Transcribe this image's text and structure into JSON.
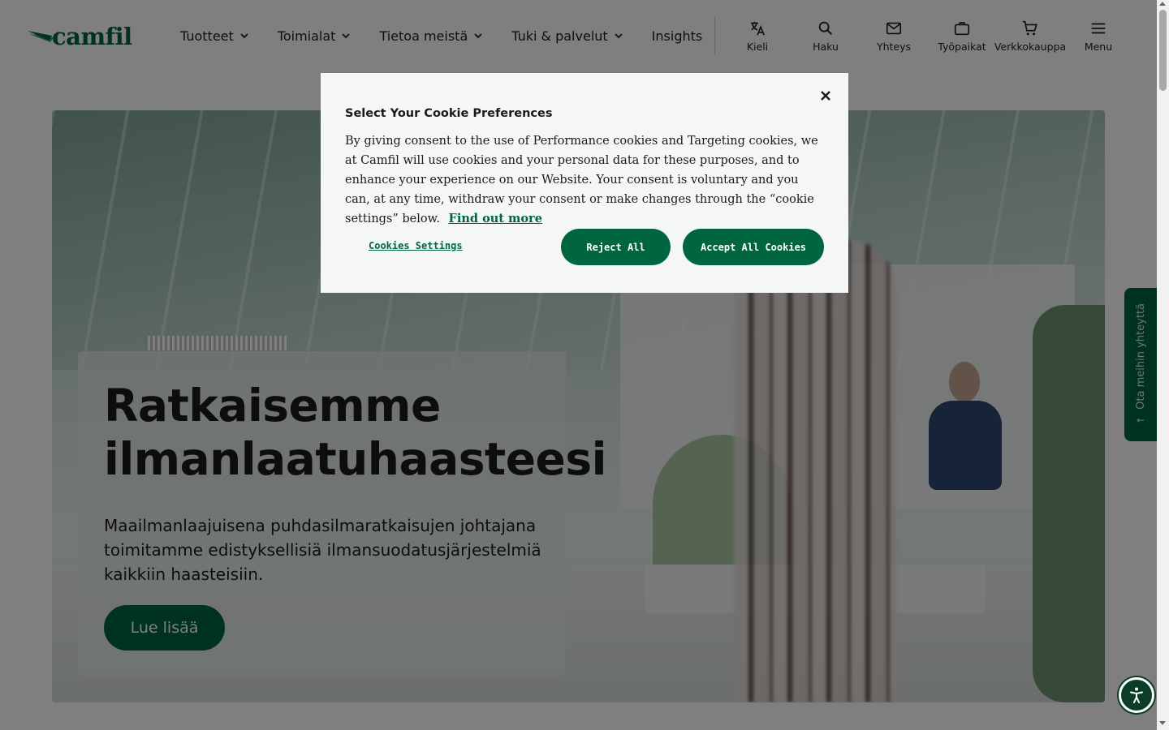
{
  "header": {
    "logo_text": "camfil",
    "nav": [
      {
        "label": "Tuotteet",
        "has_dropdown": true
      },
      {
        "label": "Toimialat",
        "has_dropdown": true
      },
      {
        "label": "Tietoa meistä",
        "has_dropdown": true
      },
      {
        "label": "Tuki & palvelut",
        "has_dropdown": true
      },
      {
        "label": "Insights",
        "has_dropdown": false
      }
    ],
    "icon_nav": [
      {
        "label": "Kieli",
        "icon": "translate-icon"
      },
      {
        "label": "Haku",
        "icon": "search-icon"
      },
      {
        "label": "Yhteys",
        "icon": "mail-icon"
      },
      {
        "label": "Työpaikat",
        "icon": "briefcase-icon"
      },
      {
        "label": "Verkkokauppa",
        "icon": "cart-icon"
      },
      {
        "label": "Menu",
        "icon": "menu-icon"
      }
    ]
  },
  "hero": {
    "title": "Ratkaisemme ilmanlaatuhaasteesi",
    "text": "Maailmanlaajuisena puhdasilmaratkaisujen johtajana toimitamme edistyksellisiä ilmansuodatusjärjestelmiä kaikkiin haasteisiin.",
    "button_label": "Lue lisää"
  },
  "cookie_modal": {
    "title": "Select Your Cookie Preferences",
    "body": "By giving consent to the use of Performance cookies and Targeting cookies, we at Camfil will use cookies and your personal data for these purposes, and to enhance your experience on our Website. Your consent is voluntary and you can, at any time, withdraw your consent or make changes through the “cookie settings” below.",
    "link_label": "Find out more",
    "settings_label": "Cookies Settings",
    "reject_label": "Reject All",
    "accept_label": "Accept All Cookies"
  },
  "side_tab": {
    "label": "Ota meihin yhteyttä",
    "arrow": "←"
  },
  "colors": {
    "brand_green": "#00663f",
    "overlay": "rgba(0,0,0,0.5)",
    "modal_bg": "#f5f7f6"
  }
}
